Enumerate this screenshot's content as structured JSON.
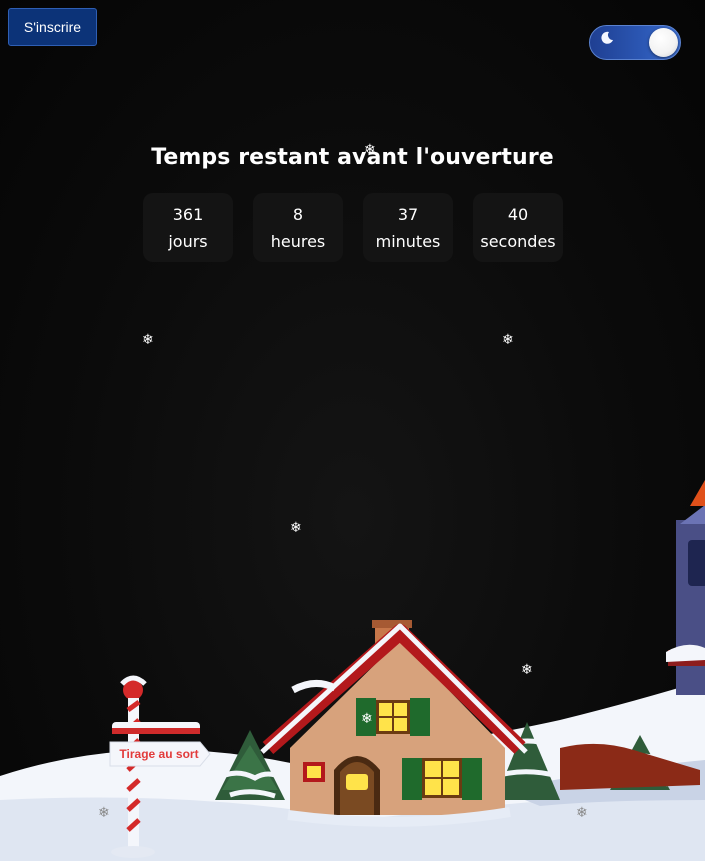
{
  "header": {
    "signup_label": "S'inscrire",
    "theme_toggle": {
      "mode": "dark",
      "icon": "moon-icon"
    }
  },
  "countdown": {
    "title": "Temps restant avant l'ouverture",
    "units": [
      {
        "value": "361",
        "label": "jours"
      },
      {
        "value": "8",
        "label": "heures"
      },
      {
        "value": "37",
        "label": "minutes"
      },
      {
        "value": "40",
        "label": "secondes"
      }
    ]
  },
  "scene": {
    "sign_label": "Tirage au sort",
    "snowflake_glyph": "❄"
  },
  "colors": {
    "background": "#0b0b0b",
    "signup_button": "#0c3378",
    "toggle_track": "#2c58b5",
    "countdown_box": "#141414",
    "sign_text": "#e23b3b",
    "roof_red": "#b3191c"
  }
}
